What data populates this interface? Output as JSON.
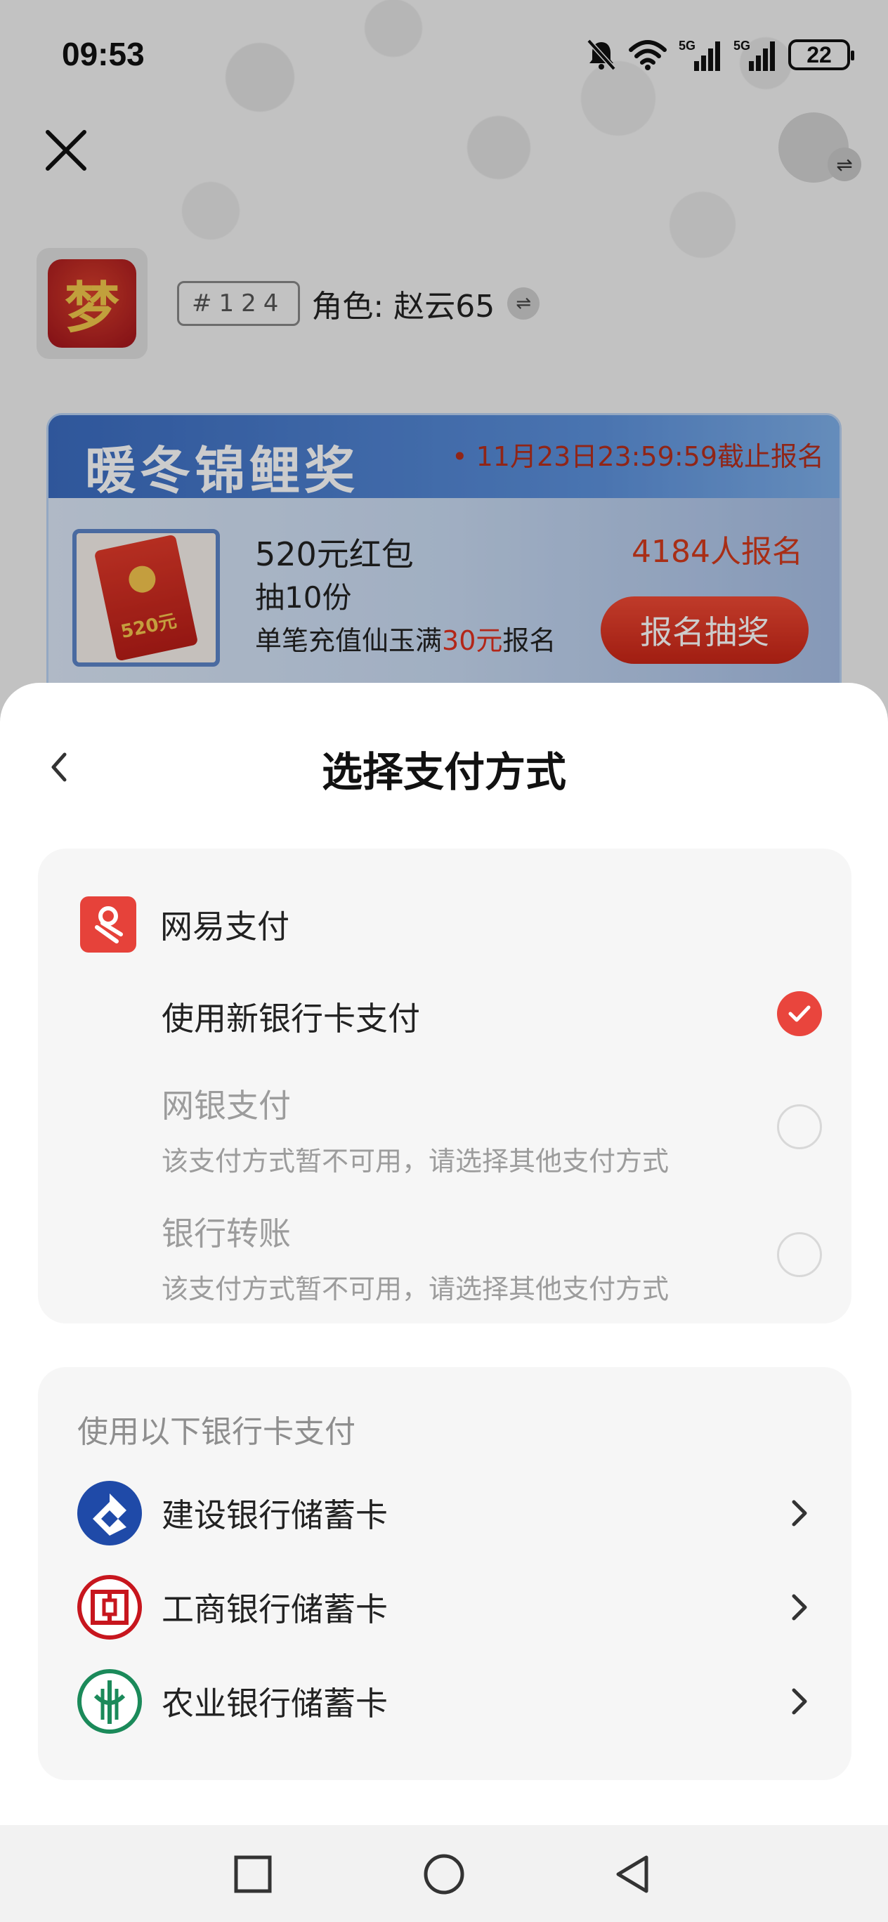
{
  "status_bar": {
    "time": "09:53",
    "battery": "22",
    "signal_1": "5G",
    "signal_2": "5G"
  },
  "background": {
    "role": {
      "server": "#124",
      "name": "角色: 赵云65"
    },
    "promo": {
      "title": "暖冬锦鲤奖",
      "deadline": "• 11月23日23:59:59截止报名",
      "gift_label": "520元",
      "prize": "520元红包",
      "count": "抽10份",
      "condition_prefix": "单笔充值仙玉满",
      "condition_amount": "30元",
      "condition_suffix": "报名",
      "participants": "4184人报名",
      "button": "报名抽奖"
    }
  },
  "sheet": {
    "title": "选择支付方式",
    "provider": {
      "name": "网易支付",
      "methods": [
        {
          "label": "使用新银行卡支付",
          "note": "",
          "enabled": true,
          "selected": true
        },
        {
          "label": "网银支付",
          "note": "该支付方式暂不可用，请选择其他支付方式",
          "enabled": false,
          "selected": false
        },
        {
          "label": "银行转账",
          "note": "该支付方式暂不可用，请选择其他支付方式",
          "enabled": false,
          "selected": false
        }
      ]
    },
    "banks": {
      "header": "使用以下银行卡支付",
      "items": [
        {
          "name": "建设银行储蓄卡",
          "color": "#1f4aa8"
        },
        {
          "name": "工商银行储蓄卡",
          "color": "#c7161e"
        },
        {
          "name": "农业银行储蓄卡",
          "color": "#1b8a5a"
        }
      ]
    }
  },
  "colors": {
    "accent": "#e9453d",
    "provider_logo": "#e6423a"
  }
}
